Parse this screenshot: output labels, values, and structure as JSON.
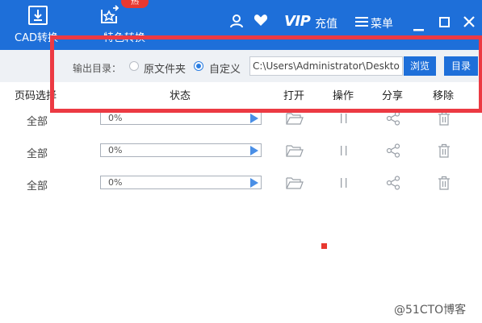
{
  "nav": {
    "cad_label": "CAD转换",
    "special_label": "特色转换",
    "hot_badge": "热"
  },
  "header": {
    "vip": "VIP",
    "recharge": "充值",
    "menu": "菜单"
  },
  "output": {
    "label": "输出目录：",
    "option_original": "原文件夹",
    "option_custom": "自定义",
    "selected": "自定义",
    "path": "C:\\Users\\Administrator\\Desktop",
    "browse": "浏览",
    "directory": "目录"
  },
  "table": {
    "headers": {
      "page": "页码选择",
      "status": "状态",
      "open": "打开",
      "operate": "操作",
      "share": "分享",
      "remove": "移除"
    },
    "rows": [
      {
        "page": "全部",
        "progress": "0%"
      },
      {
        "page": "全部",
        "progress": "0%"
      },
      {
        "page": "全部",
        "progress": "0%"
      }
    ]
  },
  "watermark": "@51CTO博客",
  "colors": {
    "primary": "#1e6fd9",
    "highlight": "#ec3a43",
    "badge": "#e8382f",
    "subbar": "#eef1f5"
  },
  "icons": [
    "cad-icon",
    "special-convert-icon",
    "user-icon",
    "heart-icon",
    "menu-icon",
    "minimize-icon",
    "maximize-icon",
    "close-icon",
    "folder-icon",
    "pause-icon",
    "share-icon",
    "trash-icon",
    "play-icon"
  ]
}
